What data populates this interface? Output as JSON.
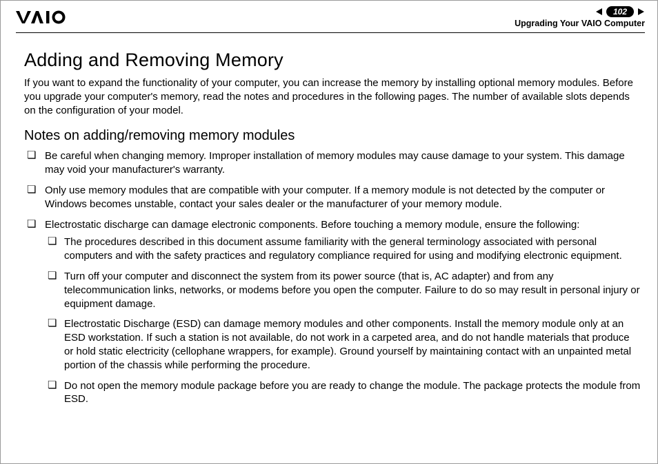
{
  "header": {
    "page_number": "102",
    "section": "Upgrading Your VAIO Computer"
  },
  "body": {
    "h1": "Adding and Removing Memory",
    "intro": "If you want to expand the functionality of your computer, you can increase the memory by installing optional memory modules. Before you upgrade your computer's memory, read the notes and procedures in the following pages. The number of available slots depends on the configuration of your model.",
    "h2": "Notes on adding/removing memory modules",
    "notes": [
      "Be careful when changing memory. Improper installation of memory modules may cause damage to your system. This damage may void your manufacturer's warranty.",
      "Only use memory modules that are compatible with your computer. If a memory module is not detected by the computer or Windows becomes unstable, contact your sales dealer or the manufacturer of your memory module.",
      "Electrostatic discharge can damage electronic components. Before touching a memory module, ensure the following:"
    ],
    "subnotes": [
      "The procedures described in this document assume familiarity with the general terminology associated with personal computers and with the safety practices and regulatory compliance required for using and modifying electronic equipment.",
      "Turn off your computer and disconnect the system from its power source (that is, AC adapter) and from any telecommunication links, networks, or modems before you open the computer. Failure to do so may result in personal injury or equipment damage.",
      "Electrostatic Discharge (ESD) can damage memory modules and other components. Install the memory module only at an ESD workstation. If such a station is not available, do not work in a carpeted area, and do not handle materials that produce or hold static electricity (cellophane wrappers, for example). Ground yourself by maintaining contact with an unpainted metal portion of the chassis while performing the procedure.",
      "Do not open the memory module package before you are ready to change the module. The package protects the module from ESD."
    ]
  }
}
